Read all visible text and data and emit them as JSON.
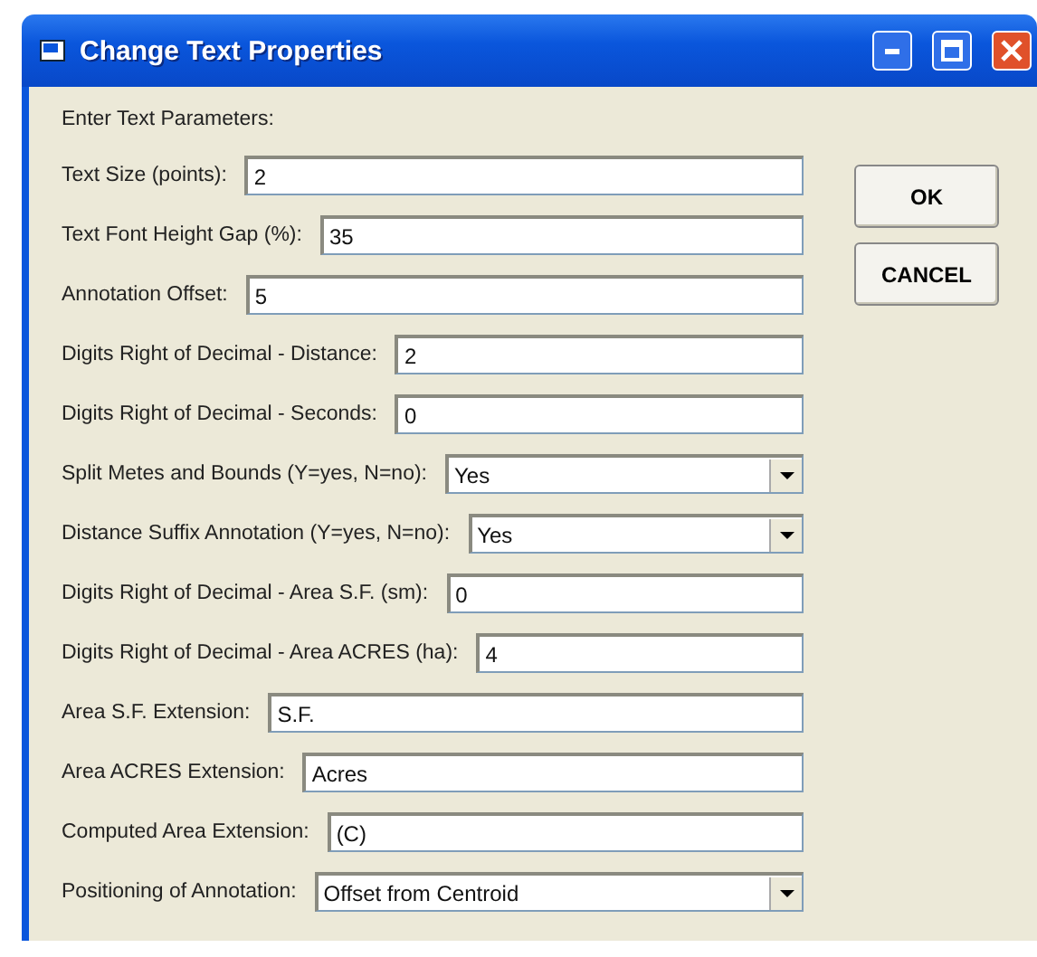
{
  "window": {
    "title": "Change Text Properties"
  },
  "heading": "Enter Text Parameters:",
  "fields": [
    {
      "kind": "text",
      "label": "Text Size (points):",
      "value": "2"
    },
    {
      "kind": "text",
      "label": "Text Font Height Gap (%):",
      "value": "35"
    },
    {
      "kind": "text",
      "label": "Annotation Offset:",
      "value": "5"
    },
    {
      "kind": "text",
      "label": "Digits Right of Decimal - Distance:",
      "value": "2"
    },
    {
      "kind": "text",
      "label": "Digits Right of Decimal - Seconds:",
      "value": "0"
    },
    {
      "kind": "dropdown",
      "label": "Split Metes and Bounds (Y=yes, N=no):",
      "value": "Yes"
    },
    {
      "kind": "dropdown",
      "label": "Distance Suffix Annotation (Y=yes, N=no):",
      "value": "Yes"
    },
    {
      "kind": "text",
      "label": "Digits Right of Decimal - Area S.F. (sm):",
      "value": "0"
    },
    {
      "kind": "text",
      "label": "Digits Right of Decimal - Area ACRES (ha):",
      "value": "4"
    },
    {
      "kind": "text",
      "label": "Area S.F. Extension:",
      "value": "S.F."
    },
    {
      "kind": "text",
      "label": "Area ACRES Extension:",
      "value": "Acres"
    },
    {
      "kind": "text",
      "label": "Computed Area Extension:",
      "value": "(C)"
    },
    {
      "kind": "dropdown",
      "label": "Positioning of Annotation:",
      "value": "Offset from Centroid"
    }
  ],
  "buttons": [
    "OK",
    "CANCEL"
  ]
}
